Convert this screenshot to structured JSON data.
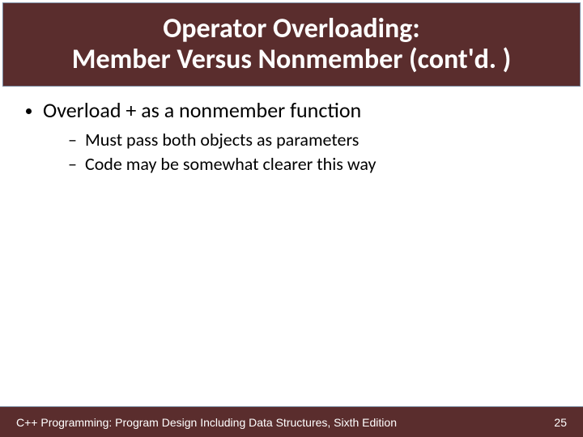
{
  "title_line1": "Operator Overloading:",
  "title_line2": "Member Versus Nonmember (cont'd. )",
  "bullets": [
    {
      "text": "Overload + as a nonmember function",
      "subs": [
        "Must pass both objects as parameters",
        "Code may be somewhat clearer this way"
      ]
    }
  ],
  "footer": {
    "text": "C++ Programming: Program Design Including Data Structures, Sixth Edition",
    "page": "25"
  }
}
